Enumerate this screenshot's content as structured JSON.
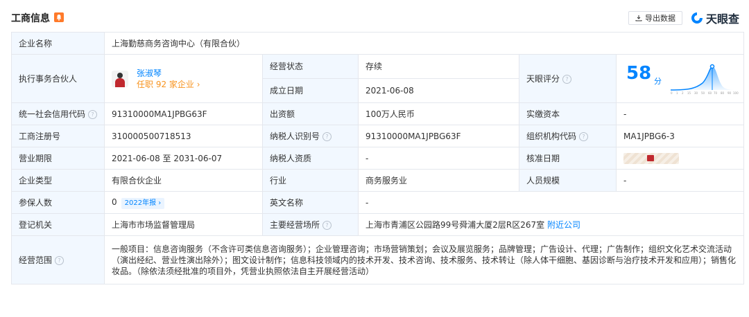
{
  "header": {
    "title": "工商信息",
    "export_label": "导出数据",
    "brand": "天眼查"
  },
  "rows": {
    "company_name": {
      "label": "企业名称",
      "value": "上海勤慈商务咨询中心（有限合伙）"
    },
    "partner": {
      "label": "执行事务合伙人",
      "name": "张淑琴",
      "count_text": "任职 92 家企业 ›"
    },
    "status": {
      "label": "经营状态",
      "value": "存续"
    },
    "founded": {
      "label": "成立日期",
      "value": "2021-06-08"
    },
    "score": {
      "label": "天眼评分",
      "value": "58",
      "unit": "分",
      "ticks": [
        "0",
        "1",
        "2",
        "15",
        "30",
        "50",
        "60",
        "70",
        "80",
        "90",
        "100"
      ]
    },
    "credit_code": {
      "label": "统一社会信用代码",
      "value": "91310000MA1JPBG63F"
    },
    "capital": {
      "label": "出资额",
      "value": "100万人民币"
    },
    "paid_capital": {
      "label": "实缴资本",
      "value": "-"
    },
    "reg_no": {
      "label": "工商注册号",
      "value": "310000500718513"
    },
    "taxpayer_id": {
      "label": "纳税人识别号",
      "value": "91310000MA1JPBG63F"
    },
    "org_code": {
      "label": "组织机构代码",
      "value": "MA1JPBG6-3"
    },
    "term": {
      "label": "营业期限",
      "value": "2021-06-08 至 2031-06-07"
    },
    "taxpayer_qual": {
      "label": "纳税人资质",
      "value": "-"
    },
    "approve_date": {
      "label": "核准日期"
    },
    "type": {
      "label": "企业类型",
      "value": "有限合伙企业"
    },
    "industry": {
      "label": "行业",
      "value": "商务服务业"
    },
    "staff_size": {
      "label": "人员规模",
      "value": "-"
    },
    "insured": {
      "label": "参保人数",
      "value": "0",
      "report_tag": "2022年报 ›"
    },
    "english_name": {
      "label": "英文名称",
      "value": "-"
    },
    "authority": {
      "label": "登记机关",
      "value": "上海市市场监督管理局"
    },
    "address": {
      "label": "主要经营场所",
      "value": "上海市青浦区公园路99号舜浦大厦2层R区267室",
      "link": "附近公司"
    },
    "scope": {
      "label": "经营范围",
      "value": "一般项目：信息咨询服务（不含许可类信息咨询服务）；企业管理咨询；市场营销策划；会议及展览服务；品牌管理；广告设计、代理；广告制作；组织文化艺术交流活动（演出经纪、营业性演出除外）；图文设计制作；信息科技领域内的技术开发、技术咨询、技术服务、技术转让（除人体干细胞、基因诊断与治疗技术开发和应用）；销售化妆品。（除依法须经批准的项目外，凭营业执照依法自主开展经营活动）"
    }
  },
  "colors": {
    "accent": "#0084ff",
    "label_bg": "#f2f8ff",
    "status_green": "#17a862",
    "orange": "#f7931e"
  }
}
